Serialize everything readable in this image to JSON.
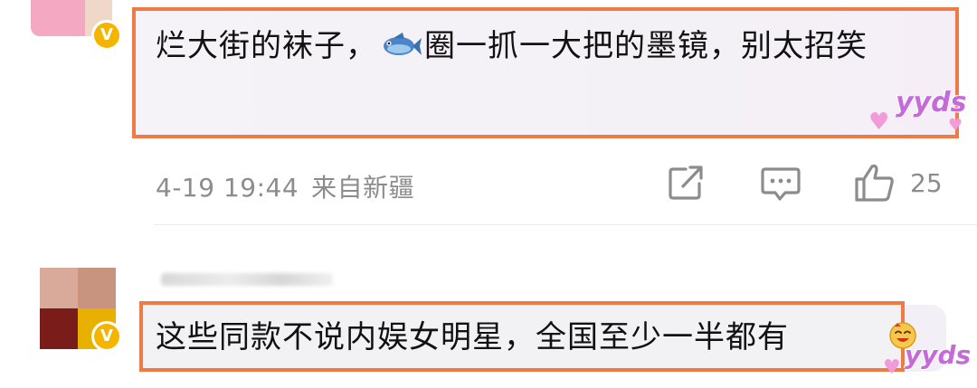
{
  "comment1": {
    "text_before": "烂大街的袜子，",
    "text_after": "圈一抓一大把的墨镜，别太招笑",
    "sticker": "yyds",
    "date": "4-19 19:44",
    "location": "来自新疆",
    "like_count": "25",
    "icons": [
      "fish-emoji-icon",
      "share-icon",
      "comment-icon",
      "like-icon",
      "verified-badge-icon"
    ]
  },
  "comment2": {
    "text": "这些同款不说内娱女明星，全国至少一半都有",
    "sticker": "yyds",
    "icons": [
      "verified-badge-icon",
      "laughing-emoji-icon"
    ]
  },
  "colors": {
    "highlight_border": "#f07a45",
    "verified_badge": "#f5b400",
    "meta_text": "#8c8c8c",
    "sticker": "#c56bd9"
  }
}
